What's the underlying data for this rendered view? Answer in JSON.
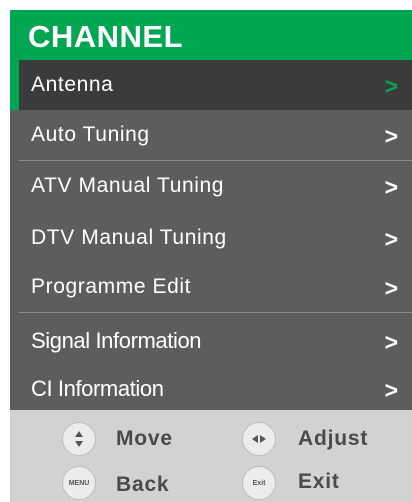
{
  "title": "CHANNEL",
  "menu_items": [
    {
      "label": "Antenna",
      "arrow": ">"
    },
    {
      "label": "Auto Tuning",
      "arrow": ">"
    },
    {
      "label": "ATV Manual Tuning",
      "arrow": ">"
    },
    {
      "label": "DTV Manual Tuning",
      "arrow": ">"
    },
    {
      "label": "Programme Edit",
      "arrow": ">"
    },
    {
      "label": "Signal Information",
      "arrow": ">"
    },
    {
      "label": "CI Information",
      "arrow": ">"
    }
  ],
  "selected_index": 0,
  "footer": {
    "move": {
      "icon": "up-down-arrows-icon",
      "label": "Move"
    },
    "adjust": {
      "icon": "left-right-arrows-icon",
      "label": "Adjust"
    },
    "back": {
      "icon_text": "MENU",
      "label": "Back"
    },
    "exit": {
      "icon_text": "Exit",
      "label": "Exit"
    }
  },
  "colors": {
    "accent": "#00a652",
    "menu_bg": "#5d5d5d",
    "selected_bg": "#3b3b3b",
    "footer_bg": "#d2d2d2"
  }
}
